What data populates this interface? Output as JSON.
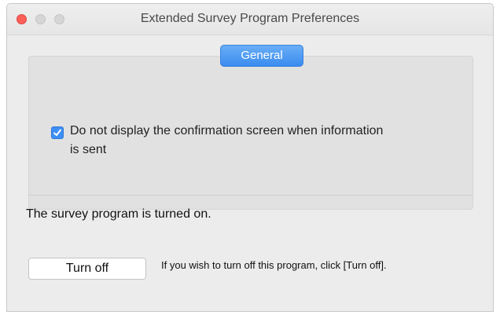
{
  "window": {
    "title": "Extended Survey Program Preferences"
  },
  "tabs": {
    "general_label": "General"
  },
  "settings": {
    "confirm_checkbox": {
      "label_line1": "Do not display the confirmation screen when information",
      "label_line2": "is sent",
      "checked": true
    }
  },
  "status": {
    "text": "The survey program is turned on."
  },
  "actions": {
    "turn_off_label": "Turn off",
    "hint": "If you wish to turn off this program, click [Turn off]."
  },
  "colors": {
    "accent": "#3d8ff5",
    "close": "#fc5f57"
  }
}
